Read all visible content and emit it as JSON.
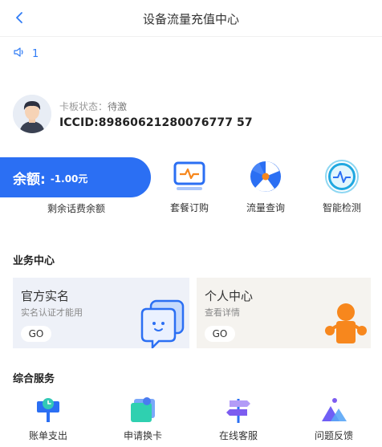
{
  "header": {
    "title": "设备流量充值中心"
  },
  "notice": {
    "text": "1"
  },
  "card": {
    "status_label": "卡板状态：",
    "status_value": "待激",
    "iccid": "ICCID:89860621280076777 57"
  },
  "balance": {
    "label": "余额:",
    "amount": "-1.00元",
    "caption": "剩余话费余额"
  },
  "quick_actions": [
    {
      "label": "套餐订购",
      "icon": "package-monitor-icon"
    },
    {
      "label": "流量查询",
      "icon": "fan-icon"
    },
    {
      "label": "智能检测",
      "icon": "pulse-check-icon"
    }
  ],
  "business": {
    "title": "业务中心",
    "cards": [
      {
        "title": "官方实名",
        "subtitle": "实名认证才能用",
        "button": "GO"
      },
      {
        "title": "个人中心",
        "subtitle": "查看详情",
        "button": "GO"
      }
    ]
  },
  "services": {
    "title": "综合服务",
    "items": [
      {
        "label": "账单支出",
        "icon": "bill-clock-icon"
      },
      {
        "label": "申请换卡",
        "icon": "card-swap-icon"
      },
      {
        "label": "在线客服",
        "icon": "signpost-icon"
      },
      {
        "label": "问题反馈",
        "icon": "mountain-feedback-icon"
      }
    ]
  },
  "colors": {
    "accent": "#2b6ff3",
    "orange": "#f7871d",
    "card_blue_bg": "#eef1f8",
    "card_beige_bg": "#f5f3ef"
  }
}
